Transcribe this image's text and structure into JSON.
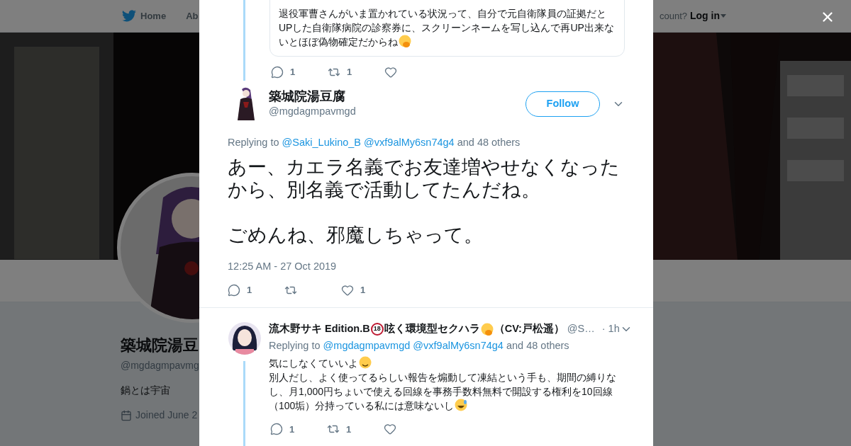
{
  "background": {
    "nav_items": [
      "Home",
      "Ab"
    ],
    "account_prompt": "count?",
    "login": "Log in",
    "profile": {
      "name": "築城院湯豆",
      "handle": "@mgdagmpavmg",
      "bio": "鍋とは宇宙",
      "joined": "Joined June 2"
    }
  },
  "modal": {
    "quoted_tweet": {
      "segments": [
        {
          "kind": "text",
          "text": "退役軍曹さんがいま置かれている状況って、自分で元自衛隊員の証拠だとUPした自衛隊病院の診察券に、スクリーンネームを写し込んで再UP出来ないとほぼ偽物確定だからね"
        },
        {
          "kind": "hand-over-mouth"
        }
      ],
      "actions": [
        {
          "kind": "reply",
          "count": "1"
        },
        {
          "kind": "retweet",
          "count": "1"
        },
        {
          "kind": "like"
        }
      ]
    },
    "main_tweet": {
      "name": "築城院湯豆腐",
      "handle": "@mgdagmpavmgd",
      "follow": "Follow",
      "replying": {
        "prefix": "Replying to",
        "mentions": [
          "@Saki_Lukino_B",
          "@vxf9alMy6sn74g4"
        ],
        "suffix": "and 48 others"
      },
      "paragraphs": [
        "あー、カエラ名義でお友達増やせなくなったから、別名義で活動してたんだね。",
        "ごめんね、邪魔しちゃって。"
      ],
      "time": "12:25 AM - 27 Oct 2019",
      "actions": [
        {
          "kind": "reply",
          "count": "1"
        },
        {
          "kind": "retweet"
        },
        {
          "kind": "like",
          "count": "1"
        }
      ]
    },
    "reply_tweet": {
      "name": [
        {
          "kind": "text",
          "text": "流木野サキ Edition.B"
        },
        {
          "kind": "age-badge",
          "text": "18"
        },
        {
          "kind": "text",
          "text": "呟く環境型セクハラ"
        },
        {
          "kind": "hand-over-mouth"
        },
        {
          "kind": "text",
          "text": "（CV:戸松遥）"
        }
      ],
      "handle": "@S…",
      "time": "· 1h",
      "replying": {
        "prefix": "Replying to",
        "mentions": [
          "@mgdagmpavmgd",
          "@vxf9alMy6sn74g4"
        ],
        "suffix": "and 48 others"
      },
      "segments": [
        {
          "kind": "text",
          "text": "気にしなくていいよ"
        },
        {
          "kind": "smiling"
        },
        {
          "kind": "break"
        },
        {
          "kind": "text",
          "text": "別人だし、よく使ってるらしい報告を煽動して凍結という手も、期間の縛りなし、月1,000円ちょいで使える回線を事務手数料無料で開設する権利を10回線（100垢）分持っている私には意味ないし"
        },
        {
          "kind": "sweat-smile"
        }
      ],
      "actions": [
        {
          "kind": "reply",
          "count": "1"
        },
        {
          "kind": "retweet",
          "count": "1"
        },
        {
          "kind": "like"
        }
      ]
    }
  }
}
